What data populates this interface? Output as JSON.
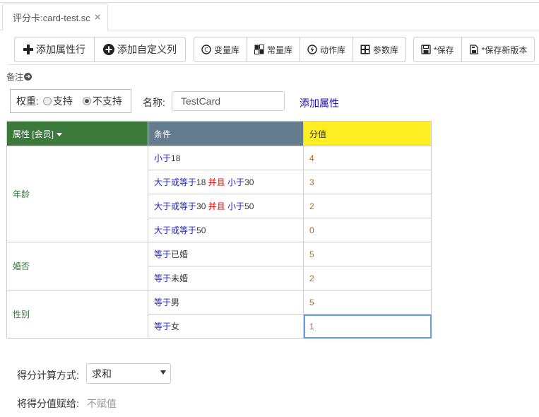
{
  "tab": {
    "title": "评分卡:card-test.sc",
    "close": "×"
  },
  "toolbar": {
    "add_attr_row": "添加属性行",
    "add_custom_col": "添加自定义列",
    "var_lib": "变量库",
    "const_lib": "常量库",
    "action_lib": "动作库",
    "param_lib": "参数库",
    "save": "*保存",
    "save_new": "*保存新版本"
  },
  "remark": "备注",
  "weight": {
    "label": "权重:",
    "opt_support": "支持",
    "opt_nosupport": "不支持",
    "selected": "不支持"
  },
  "name": {
    "label": "名称:",
    "value": "TestCard"
  },
  "add_attribute_link": "添加属性",
  "table": {
    "headers": {
      "attr": "属性 [会员]",
      "cond": "条件",
      "score": "分值"
    },
    "groups": [
      {
        "attr": "年龄",
        "rows": [
          {
            "cond": [
              [
                "b",
                "小于"
              ],
              [
                "n",
                "18"
              ]
            ],
            "score": "4"
          },
          {
            "cond": [
              [
                "b",
                "大于或等于"
              ],
              [
                "n",
                "18 "
              ],
              [
                "r",
                "并且"
              ],
              [
                "b",
                " 小于"
              ],
              [
                "n",
                "30"
              ]
            ],
            "score": "3"
          },
          {
            "cond": [
              [
                "b",
                "大于或等于"
              ],
              [
                "n",
                "30 "
              ],
              [
                "r",
                "并且"
              ],
              [
                "b",
                " 小于"
              ],
              [
                "n",
                "50"
              ]
            ],
            "score": "2"
          },
          {
            "cond": [
              [
                "b",
                "大于或等于"
              ],
              [
                "n",
                "50"
              ]
            ],
            "score": "0"
          }
        ]
      },
      {
        "attr": "婚否",
        "rows": [
          {
            "cond": [
              [
                "b",
                "等于"
              ],
              [
                "n",
                "已婚"
              ]
            ],
            "score": "5"
          },
          {
            "cond": [
              [
                "b",
                "等于"
              ],
              [
                "n",
                "未婚"
              ]
            ],
            "score": "2"
          }
        ]
      },
      {
        "attr": "性别",
        "rows": [
          {
            "cond": [
              [
                "b",
                "等于"
              ],
              [
                "n",
                "男"
              ]
            ],
            "score": "5"
          },
          {
            "cond": [
              [
                "b",
                "等于"
              ],
              [
                "n",
                "女"
              ]
            ],
            "score": "1"
          }
        ]
      }
    ]
  },
  "calc": {
    "label": "得分计算方式:",
    "value": "求和"
  },
  "assign": {
    "label": "将得分值赋给:",
    "value": "不赋值"
  },
  "colors": {
    "attr_header": "#3b7a3b",
    "cond_header": "#647d8e",
    "score_header": "#ffee22"
  }
}
